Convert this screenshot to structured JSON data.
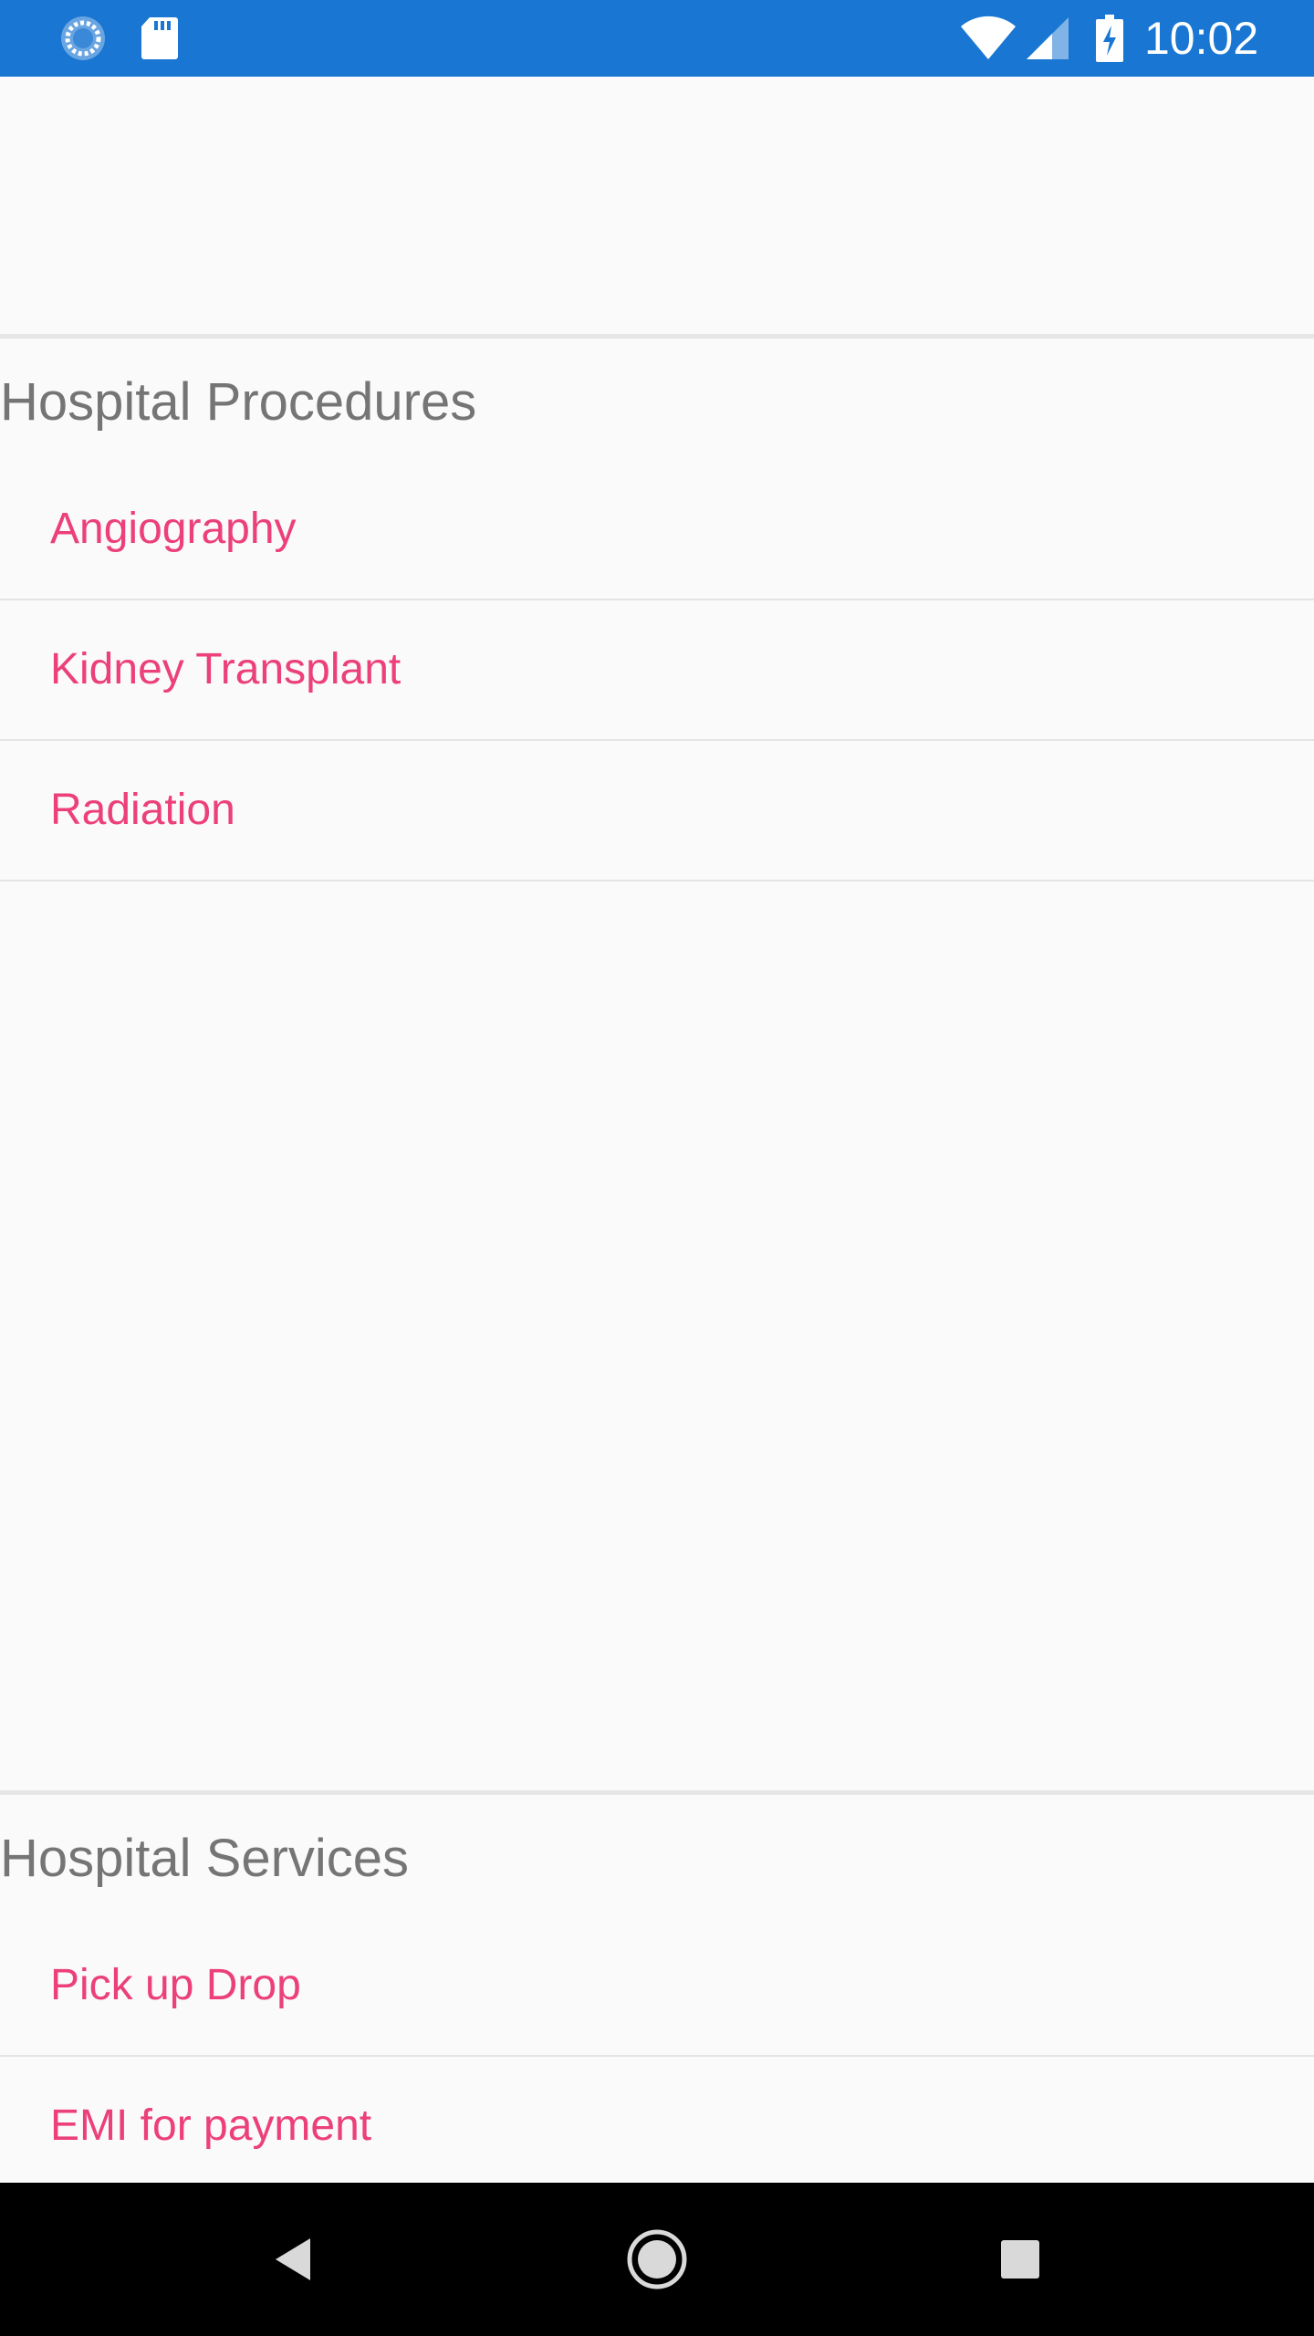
{
  "status_bar": {
    "time": "10:02",
    "icons": [
      "sync-icon",
      "sd-card-icon",
      "wifi-icon",
      "cell-signal-icon",
      "battery-charging-icon"
    ],
    "background_color": "#1976d2"
  },
  "sections": [
    {
      "title": "Hospital Procedures",
      "items": [
        {
          "label": "Angiography"
        },
        {
          "label": "Kidney Transplant"
        },
        {
          "label": "Radiation"
        }
      ]
    },
    {
      "title": "Hospital Services",
      "items": [
        {
          "label": "Pick up Drop"
        },
        {
          "label": "EMI for payment"
        }
      ]
    }
  ],
  "colors": {
    "item_text": "#ec407a",
    "section_title": "#757575",
    "background": "#fafafa"
  },
  "nav_bar": {
    "icons": [
      "back-icon",
      "home-icon",
      "recents-icon"
    ]
  }
}
